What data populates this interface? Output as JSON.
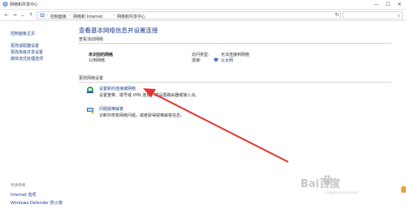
{
  "window": {
    "title": "网络和共享中心",
    "minimize": "—",
    "maximize": "☐",
    "close": "✕"
  },
  "address": {
    "crumbs": [
      "控制面板",
      "网络和 Internet",
      "网络和共享中心"
    ],
    "separator": "›",
    "search_placeholder": ""
  },
  "sidebar": {
    "top_link": "控制面板主页",
    "links": [
      "更改适配器设置",
      "更改高级共享设置",
      "媒体流式处理选项"
    ],
    "see_also_heading": "另请参阅",
    "see_also": [
      "Internet 选项",
      "Windows Defender 防火墙"
    ]
  },
  "main": {
    "title": "查看基本网络信息并设置连接",
    "active_networks_label": "查看活动网络",
    "network_name": "未识别的网络",
    "network_type": "公用网络",
    "access_type_label": "访问类型:",
    "access_type_value": "无法连接到网络",
    "connections_label": "连接:",
    "connection_value": "以太网",
    "change_settings_label": "更改网络设置",
    "tasks": [
      {
        "title": "设置新的连接或网络",
        "desc": "设置宽带、拨号或 VPN 连接；或设置路由器或接入点。"
      },
      {
        "title": "问题疑难解答",
        "desc": "诊断并修复网络问题，或者获得疑难解答信息。"
      }
    ]
  },
  "watermark": {
    "brand": "Bai百度",
    "sub": "jingyan.baidu.com"
  },
  "colors": {
    "link": "#1a3f8c",
    "title": "#1e3b8a",
    "arrow": "#e8322a"
  }
}
